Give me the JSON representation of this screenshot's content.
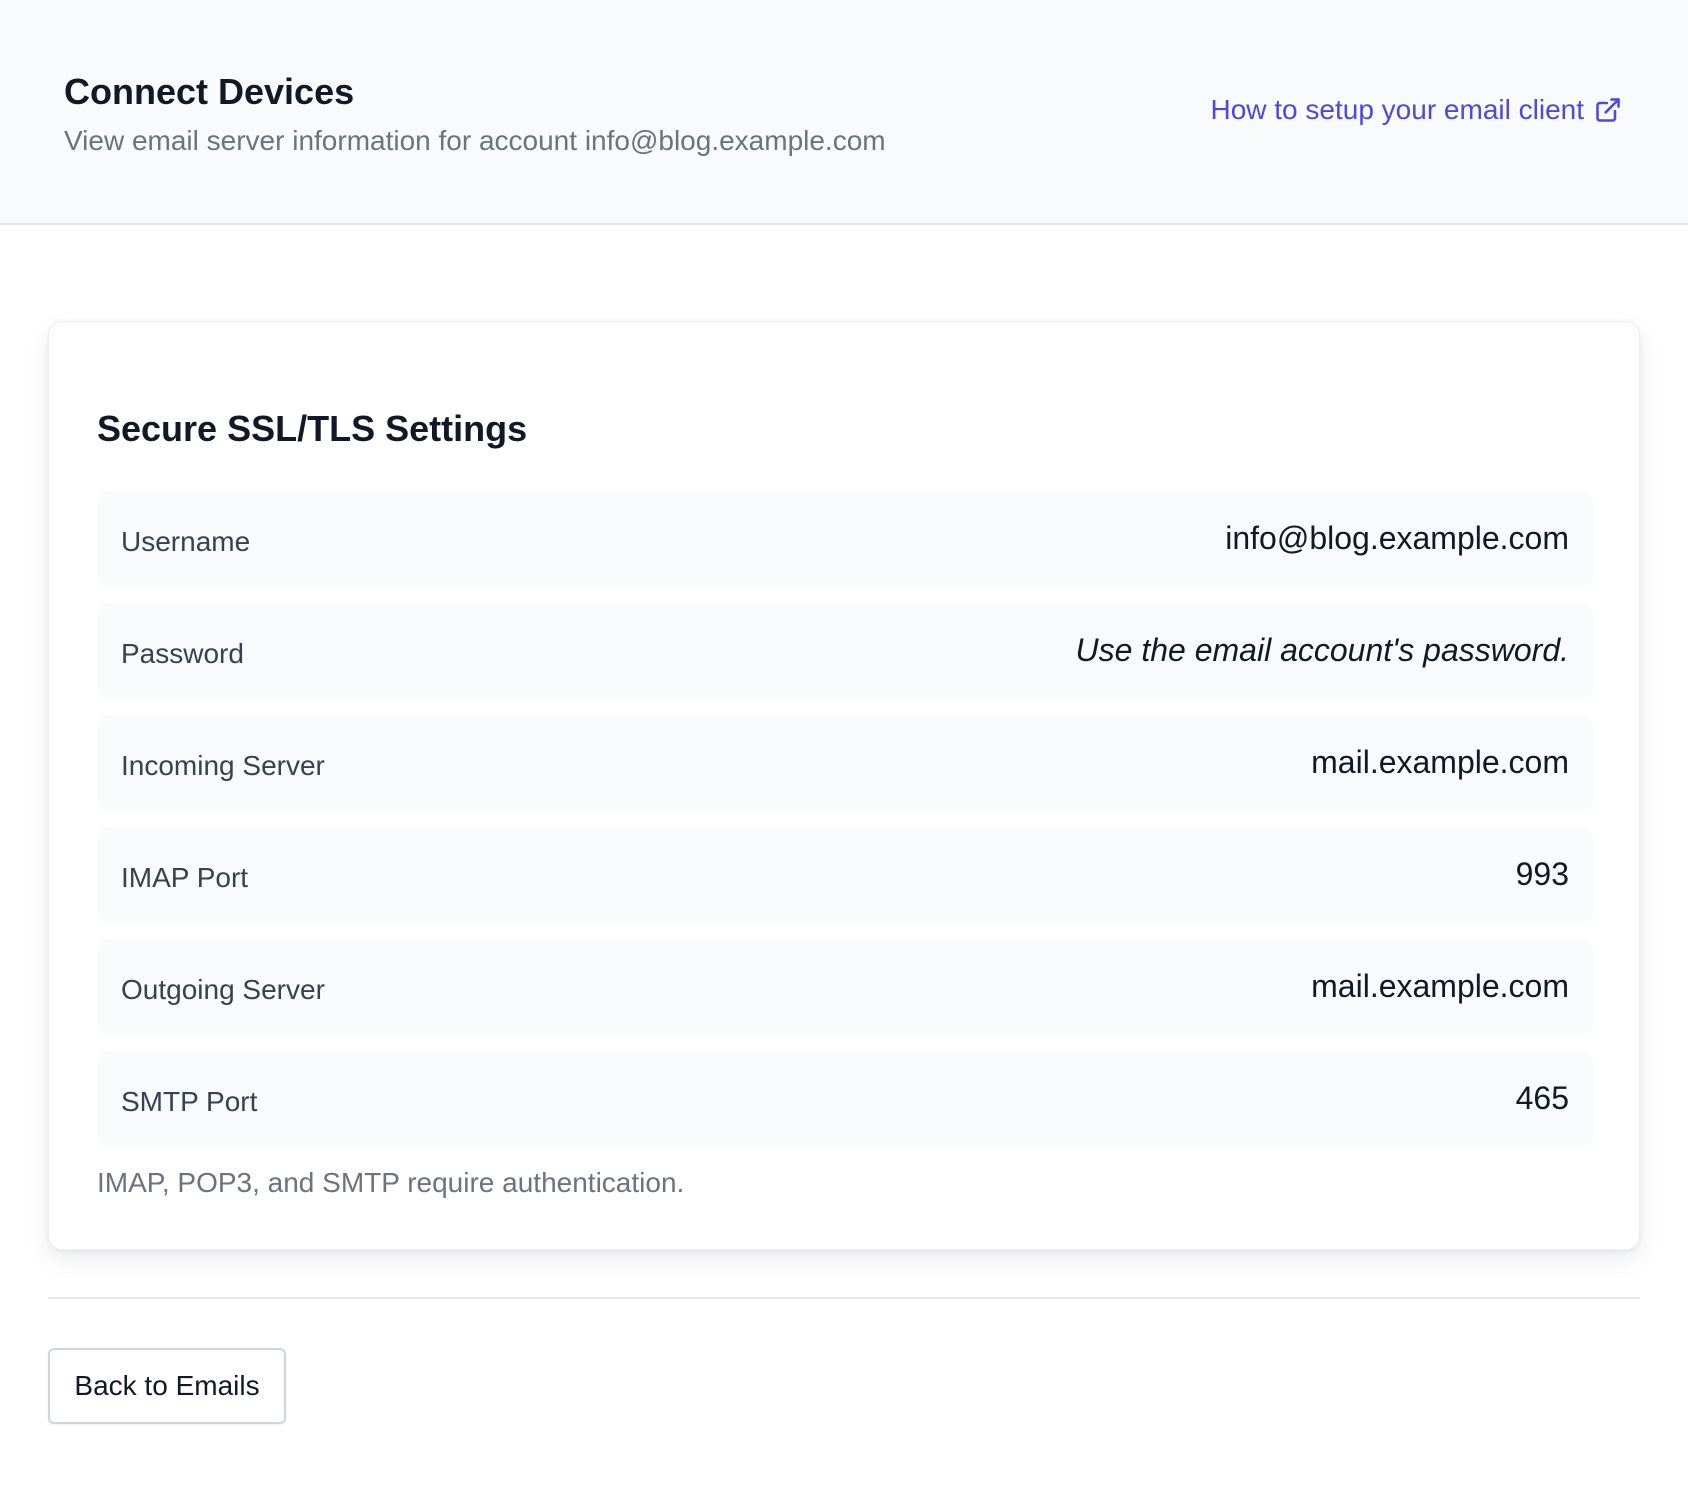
{
  "header": {
    "title": "Connect Devices",
    "subtitle": "View email server information for account info@blog.example.com",
    "setup_link_label": "How to setup your email client",
    "setup_link_icon": "external-link-icon"
  },
  "card": {
    "title": "Secure SSL/TLS Settings",
    "rows": [
      {
        "label": "Username",
        "value": "info@blog.example.com"
      },
      {
        "label": "Password",
        "value": "Use the email account's password."
      },
      {
        "label": "Incoming Server",
        "value": "mail.example.com"
      },
      {
        "label": "IMAP Port",
        "value": "993"
      },
      {
        "label": "Outgoing Server",
        "value": "mail.example.com"
      },
      {
        "label": "SMTP Port",
        "value": "465"
      }
    ],
    "note": "IMAP, POP3, and SMTP require authentication."
  },
  "footer": {
    "back_button_label": "Back to Emails"
  },
  "colors": {
    "accent": "#4f46e5",
    "header_bg": "#f9fafb",
    "row_bg": "#f9fafb",
    "muted_text": "#6b7280"
  }
}
